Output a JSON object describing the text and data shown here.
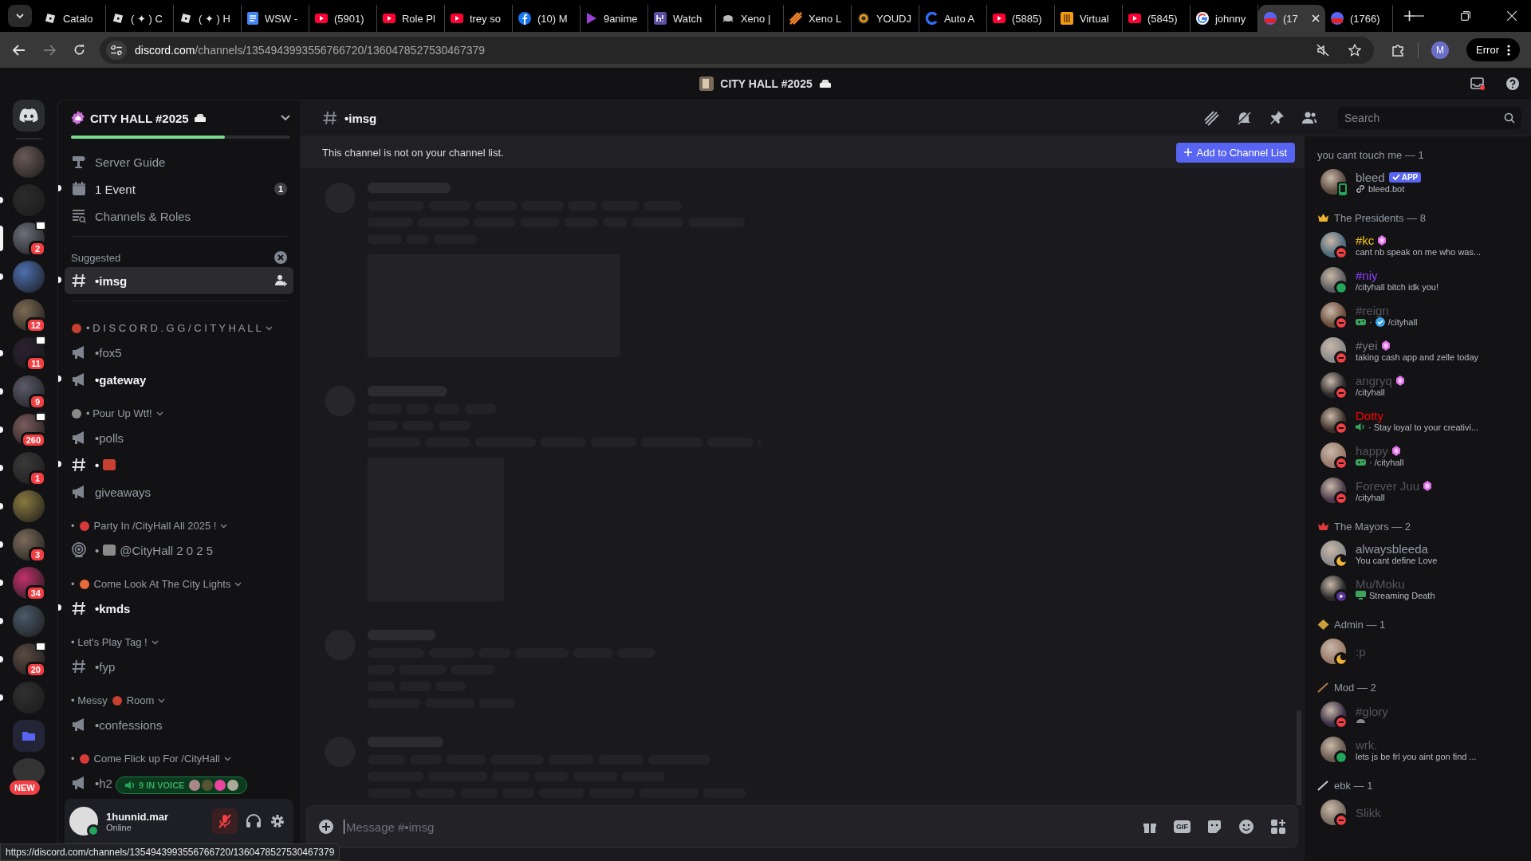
{
  "browser": {
    "tabs": [
      {
        "title": "Catalo",
        "selected": false
      },
      {
        "title": "( ✦ ) C",
        "selected": false
      },
      {
        "title": "( ✦ ) H",
        "selected": false
      },
      {
        "title": "WSW -",
        "selected": false
      },
      {
        "title": "(5901)",
        "selected": false
      },
      {
        "title": "Role Pl",
        "selected": false
      },
      {
        "title": "trey so",
        "selected": false
      },
      {
        "title": "(10) M",
        "selected": false
      },
      {
        "title": "9anime",
        "selected": false
      },
      {
        "title": "Watch",
        "selected": false
      },
      {
        "title": "Xeno |",
        "selected": false
      },
      {
        "title": "Xeno L",
        "selected": false
      },
      {
        "title": "YOUDJ",
        "selected": false
      },
      {
        "title": "Auto A",
        "selected": false
      },
      {
        "title": "(5885)",
        "selected": false
      },
      {
        "title": "Virtual",
        "selected": false
      },
      {
        "title": "(5845)",
        "selected": false
      },
      {
        "title": "johnny",
        "selected": false
      },
      {
        "title": "(17",
        "selected": true
      },
      {
        "title": "(1766)",
        "selected": false
      }
    ],
    "address": {
      "host": "discord.com",
      "path": "/channels/1354943993556766720/1360478527530467379"
    },
    "profile_initial": "M",
    "error_label": "Error"
  },
  "app_title": "CITY HALL #2025",
  "servers": [
    {
      "unread": false,
      "selected": false,
      "voice": false
    },
    {
      "unread": true,
      "selected": false,
      "voice": false
    },
    {
      "badge": "2",
      "unread": false,
      "selected": true,
      "voice": true
    },
    {
      "unread": true,
      "selected": false,
      "voice": false
    },
    {
      "badge": "12",
      "unread": false,
      "selected": false,
      "voice": false
    },
    {
      "badge": "11",
      "unread": true,
      "selected": false,
      "voice": true
    },
    {
      "badge": "9",
      "unread": true,
      "selected": false,
      "voice": false
    },
    {
      "badge": "260",
      "unread": true,
      "selected": false,
      "voice": true
    },
    {
      "badge": "1",
      "unread": true,
      "selected": false,
      "voice": false
    },
    {
      "unread": true,
      "selected": false,
      "voice": false
    },
    {
      "badge": "3",
      "unread": true,
      "selected": false,
      "voice": false
    },
    {
      "badge": "34",
      "unread": true,
      "selected": false,
      "voice": false
    },
    {
      "unread": true,
      "selected": false,
      "voice": false
    },
    {
      "badge": "20",
      "unread": true,
      "selected": false,
      "voice": true
    },
    {
      "unread": true,
      "selected": false,
      "voice": false
    }
  ],
  "new_badge": "NEW",
  "server": {
    "name": "CITY HALL #2025",
    "boost": {
      "level": 0.7
    }
  },
  "sidebar": {
    "items": [
      {
        "kind": "nav",
        "label": "Server Guide",
        "unread": false
      },
      {
        "kind": "nav",
        "label": "1 Event",
        "badge": "1",
        "unread": true
      },
      {
        "kind": "nav",
        "label": "Channels & Roles",
        "unread": false
      },
      {
        "kind": "divider"
      },
      {
        "kind": "heading",
        "label": "Suggested"
      },
      {
        "kind": "text_channel",
        "segments": [
          {
            "kind": "text",
            "text": "•imsg"
          }
        ],
        "unread": true,
        "selected": true
      },
      {
        "kind": "divider"
      },
      {
        "kind": "category",
        "segments": [
          {
            "kind": "emoji"
          },
          {
            "kind": "text",
            "text": "• D I S C O R D . G G / C I T Y H A L L"
          }
        ]
      },
      {
        "kind": "announcement_channel",
        "segments": [
          {
            "kind": "text",
            "text": "•fox5"
          }
        ],
        "unread": false,
        "selected": false
      },
      {
        "kind": "announcement_channel",
        "segments": [
          {
            "kind": "text",
            "text": "•gateway"
          }
        ],
        "unread": true,
        "selected": false
      },
      {
        "kind": "category",
        "segments": [
          {
            "kind": "emoji"
          },
          {
            "kind": "text",
            "text": "• Pour Up Wtf!"
          }
        ]
      },
      {
        "kind": "announcement_channel",
        "segments": [
          {
            "kind": "text",
            "text": "•polls"
          }
        ],
        "unread": false,
        "selected": false
      },
      {
        "kind": "text_channel",
        "segments": [
          {
            "kind": "text",
            "text": "•"
          },
          {
            "kind": "emoji"
          }
        ],
        "unread": true,
        "selected": false
      },
      {
        "kind": "announcement_channel",
        "segments": [
          {
            "kind": "text",
            "text": "giveaways"
          }
        ],
        "unread": false,
        "selected": false
      },
      {
        "kind": "category",
        "segments": [
          {
            "kind": "text",
            "text": "•"
          },
          {
            "kind": "emoji"
          },
          {
            "kind": "text",
            "text": "Party In /CityHall All 2025 !"
          }
        ]
      },
      {
        "kind": "stage_channel",
        "segments": [
          {
            "kind": "text",
            "text": "•"
          },
          {
            "kind": "emoji"
          },
          {
            "kind": "text",
            "text": "@CityHall 2 0 2 5"
          }
        ],
        "unread": false,
        "selected": false
      },
      {
        "kind": "category",
        "segments": [
          {
            "kind": "text",
            "text": "•"
          },
          {
            "kind": "emoji"
          },
          {
            "kind": "text",
            "text": "Come Look At The City Lights"
          }
        ]
      },
      {
        "kind": "text_channel",
        "segments": [
          {
            "kind": "text",
            "text": "•kmds"
          }
        ],
        "unread": true,
        "selected": false
      },
      {
        "kind": "category",
        "segments": [
          {
            "kind": "text",
            "text": "• Let's Play Tag !"
          }
        ]
      },
      {
        "kind": "text_channel",
        "segments": [
          {
            "kind": "text",
            "text": "•fyp"
          }
        ],
        "unread": false,
        "selected": false
      },
      {
        "kind": "category",
        "segments": [
          {
            "kind": "text",
            "text": "• Messy"
          },
          {
            "kind": "emoji"
          },
          {
            "kind": "text",
            "text": "Room"
          }
        ]
      },
      {
        "kind": "announcement_channel",
        "segments": [
          {
            "kind": "text",
            "text": "•confessions"
          }
        ],
        "unread": false,
        "selected": false
      },
      {
        "kind": "category",
        "segments": [
          {
            "kind": "text",
            "text": "•"
          },
          {
            "kind": "emoji"
          },
          {
            "kind": "text",
            "text": "Come Flick up For /CityHall"
          }
        ]
      },
      {
        "kind": "announcement_channel",
        "segments": [
          {
            "kind": "text",
            "text": "•h2"
          }
        ],
        "unread": false,
        "selected": false
      }
    ]
  },
  "voice_pill": {
    "label": "9 IN VOICE"
  },
  "user": {
    "name": "1hunnid.mar",
    "status_text": "Online",
    "muted": true
  },
  "channel": {
    "name": "•imsg",
    "notice": "This channel is not on your channel list.",
    "add_button": "Add to Channel List",
    "input_placeholder": "Message #•imsg",
    "gif_label": "GIF"
  },
  "search": {
    "placeholder": "Search"
  },
  "members": {
    "groups": [
      {
        "title": "you cant touch me — 1",
        "members": [
          {
            "name": "bleed",
            "color": "#949ba4",
            "kind": "mobile",
            "nitro": false,
            "app_badge": "APP",
            "subtitle": [
              {
                "kind": "link"
              },
              {
                "kind": "text",
                "text": "bleed.bot"
              }
            ]
          }
        ]
      },
      {
        "title": "The Presidents — 8",
        "members": [
          {
            "name": "#kc",
            "color": "#f1c40f",
            "kind": "dnd",
            "nitro": true,
            "subtitle": [
              {
                "kind": "text",
                "text": "cant nb speak on me who was..."
              }
            ]
          },
          {
            "name": "#niy",
            "color": "#8b3dff",
            "kind": "online",
            "nitro": false,
            "subtitle": [
              {
                "kind": "text",
                "text": "/cityhall bitch idk you!"
              }
            ]
          },
          {
            "name": "#reign",
            "color": "#55565e",
            "kind": "dnd",
            "nitro": false,
            "subtitle": [
              {
                "kind": "game"
              },
              {
                "kind": "text",
                "text": "·"
              },
              {
                "kind": "verified"
              },
              {
                "kind": "text",
                "text": "/cityhall"
              }
            ]
          },
          {
            "name": "#yei",
            "color": "#72747d",
            "kind": "dnd",
            "nitro": true,
            "subtitle": [
              {
                "kind": "text",
                "text": "taking cash app and zelle today"
              }
            ]
          },
          {
            "name": "angryq",
            "color": "#55565e",
            "kind": "dnd",
            "nitro": true,
            "subtitle": [
              {
                "kind": "text",
                "text": "/cityhall"
              }
            ]
          },
          {
            "name": "Dotty",
            "color": "#ff0000",
            "kind": "dnd",
            "nitro": false,
            "subtitle": [
              {
                "kind": "voice"
              },
              {
                "kind": "text",
                "text": "· Stay loyal to your creativi..."
              }
            ]
          },
          {
            "name": "happy",
            "color": "#55565e",
            "kind": "dnd",
            "nitro": true,
            "subtitle": [
              {
                "kind": "game"
              },
              {
                "kind": "text",
                "text": "· /cityhall"
              }
            ]
          },
          {
            "name": "Forever Juu",
            "color": "#55565e",
            "kind": "dnd",
            "nitro": true,
            "subtitle": [
              {
                "kind": "text",
                "text": "/cityhall"
              }
            ]
          }
        ]
      },
      {
        "title": "The Mayors — 2",
        "members": [
          {
            "name": "alwaysbleeda",
            "color": "#949ba4",
            "kind": "idle",
            "nitro": false,
            "subtitle": [
              {
                "kind": "text",
                "text": "You cant define Love"
              }
            ]
          },
          {
            "name": "Mu/Moku",
            "color": "#55565e",
            "kind": "streaming",
            "nitro": false,
            "subtitle": [
              {
                "kind": "stream"
              },
              {
                "kind": "text",
                "text": "Streaming Death"
              }
            ]
          }
        ]
      },
      {
        "title": "Admin — 1",
        "members": [
          {
            "name": ":p",
            "color": "#55565e",
            "kind": "idle",
            "nitro": false
          }
        ]
      },
      {
        "title": "Mod — 2",
        "members": [
          {
            "name": "#glory",
            "color": "#55565e",
            "kind": "dnd",
            "nitro": false,
            "subtitle": [
              {
                "kind": "emoji"
              }
            ]
          },
          {
            "name": "wrk.",
            "color": "#55565e",
            "kind": "online",
            "nitro": false,
            "subtitle": [
              {
                "kind": "text",
                "text": "lets js be frl you aint gon find ..."
              }
            ]
          }
        ]
      },
      {
        "title": "ebk — 1",
        "members": [
          {
            "name": "Slikk",
            "color": "#55565e",
            "kind": "dnd",
            "nitro": false
          }
        ]
      }
    ]
  },
  "status_url": "https://discord.com/channels/1354943993556766720/1360478527530467379"
}
